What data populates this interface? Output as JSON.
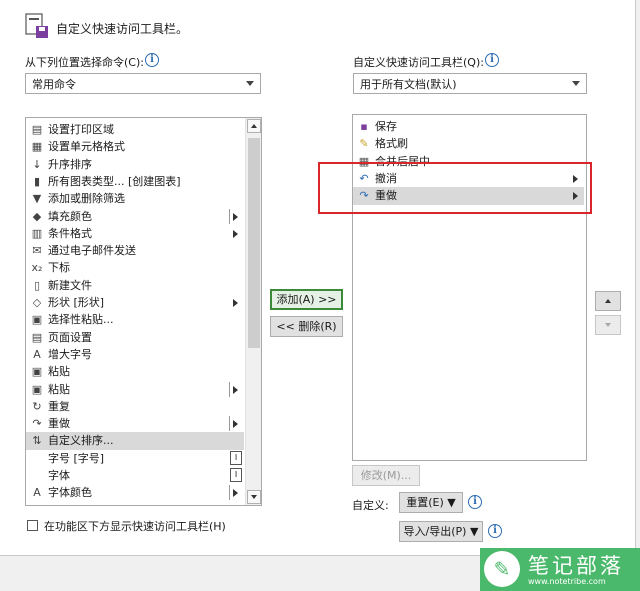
{
  "header": {
    "title": "自定义快速访问工具栏。"
  },
  "left": {
    "label": "从下列位置选择命令(C):",
    "dropdown_value": "常用命令",
    "items": [
      {
        "label": "设置打印区域",
        "icon": "print-area-icon",
        "glyph": "▤",
        "submenu": false
      },
      {
        "label": "设置单元格格式",
        "icon": "format-cells-icon",
        "glyph": "▦",
        "submenu": false
      },
      {
        "label": "升序排序",
        "icon": "sort-ascending-icon",
        "glyph": "↓",
        "submenu": false
      },
      {
        "label": "所有图表类型... [创建图表]",
        "icon": "chart-icon",
        "glyph": "▮",
        "submenu": false
      },
      {
        "label": "添加或删除筛选",
        "icon": "filter-icon",
        "glyph": "▼",
        "submenu": false
      },
      {
        "label": "填充颜色",
        "icon": "fill-color-icon",
        "glyph": "◆",
        "submenu": true,
        "sep": true
      },
      {
        "label": "条件格式",
        "icon": "conditional-format-icon",
        "glyph": "▥",
        "submenu": true
      },
      {
        "label": "通过电子邮件发送",
        "icon": "email-icon",
        "glyph": "✉",
        "submenu": false
      },
      {
        "label": "下标",
        "icon": "subscript-icon",
        "glyph": "x₂",
        "submenu": false
      },
      {
        "label": "新建文件",
        "icon": "new-file-icon",
        "glyph": "▯",
        "submenu": false
      },
      {
        "label": "形状 [形状]",
        "icon": "shapes-icon",
        "glyph": "◇",
        "submenu": true
      },
      {
        "label": "选择性粘贴...",
        "icon": "paste-special-icon",
        "glyph": "▣",
        "submenu": false
      },
      {
        "label": "页面设置",
        "icon": "page-setup-icon",
        "glyph": "▤",
        "submenu": false
      },
      {
        "label": "增大字号",
        "icon": "increase-font-icon",
        "glyph": "A",
        "submenu": false
      },
      {
        "label": "粘贴",
        "icon": "paste-icon",
        "glyph": "▣",
        "submenu": false
      },
      {
        "label": "粘贴",
        "icon": "paste-icon",
        "glyph": "▣",
        "submenu": true,
        "sep": true
      },
      {
        "label": "重复",
        "icon": "repeat-icon",
        "glyph": "↻",
        "submenu": false
      },
      {
        "label": "重做",
        "icon": "redo-icon",
        "glyph": "↷",
        "submenu": true,
        "sep": true
      },
      {
        "label": "自定义排序...",
        "icon": "custom-sort-icon",
        "glyph": "⇅",
        "submenu": false,
        "selected": true
      },
      {
        "label": "字号 [字号]",
        "icon": "",
        "glyph": "",
        "submenu": false,
        "combo": true
      },
      {
        "label": "字体",
        "icon": "",
        "glyph": "",
        "submenu": false,
        "combo": true
      },
      {
        "label": "字体颜色",
        "icon": "font-color-icon",
        "glyph": "A",
        "submenu": true,
        "sep": true
      }
    ]
  },
  "right": {
    "label": "自定义快速访问工具栏(Q):",
    "dropdown_value": "用于所有文档(默认)",
    "items": [
      {
        "label": "保存",
        "icon": "save-icon",
        "glyph": "▪",
        "submenu": false
      },
      {
        "label": "格式刷",
        "icon": "format-painter-icon",
        "glyph": "✎",
        "submenu": false
      },
      {
        "label": "合并后居中",
        "icon": "merge-center-icon",
        "glyph": "▦",
        "submenu": false
      },
      {
        "label": "撤消",
        "icon": "undo-icon",
        "glyph": "↶",
        "submenu": true
      },
      {
        "label": "重做",
        "icon": "redo-icon",
        "glyph": "↷",
        "submenu": true,
        "selected": true
      }
    ]
  },
  "buttons": {
    "add": "添加(A) >>",
    "remove": "<< 删除(R)",
    "modify": "修改(M)...",
    "customize_label": "自定义:",
    "reset": "重置(E) ▼",
    "import_export": "导入/导出(P) ▼"
  },
  "checkbox": {
    "label": "在功能区下方显示快速访问工具栏(H)",
    "checked": false
  },
  "watermark": {
    "title": "笔记部落",
    "url": "www.notetribe.com"
  },
  "colors": {
    "highlight": "#d9262b",
    "selected_row": "#d9d9d9",
    "brand_green": "#4bb96b"
  }
}
